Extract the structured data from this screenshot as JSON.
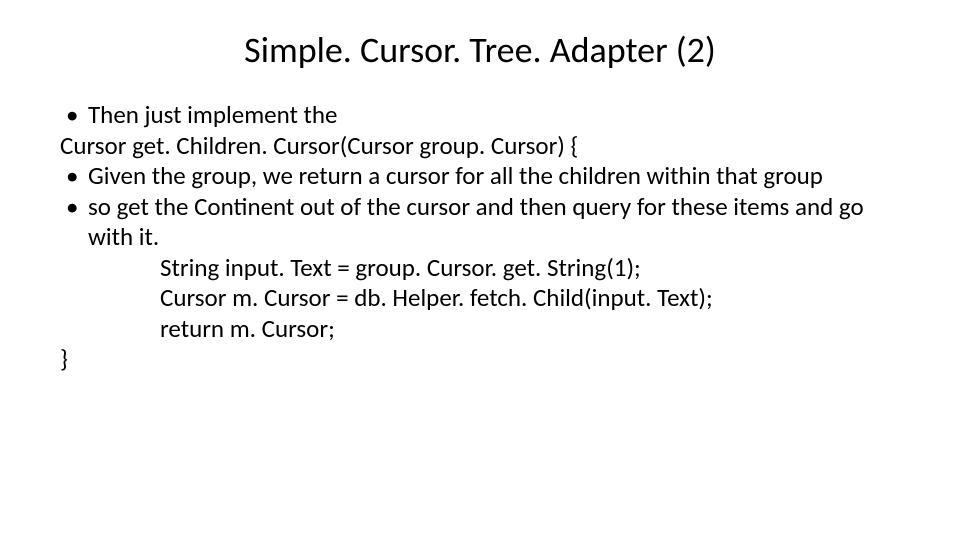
{
  "title": "Simple. Cursor. Tree. Adapter (2)",
  "body": {
    "b1": "Then just implement the",
    "line_sig": "Cursor get. Children. Cursor(Cursor group. Cursor)  {",
    "b2": "Given the group, we return a cursor for all the children within that group",
    "b3": "so get the Continent out of the cursor and then query for these items and go with it.",
    "code1": "String input. Text = group. Cursor. get. String(1);",
    "code2": "Cursor m. Cursor = db. Helper. fetch. Child(input. Text);",
    "code3": " return m. Cursor;",
    "close": "}"
  }
}
